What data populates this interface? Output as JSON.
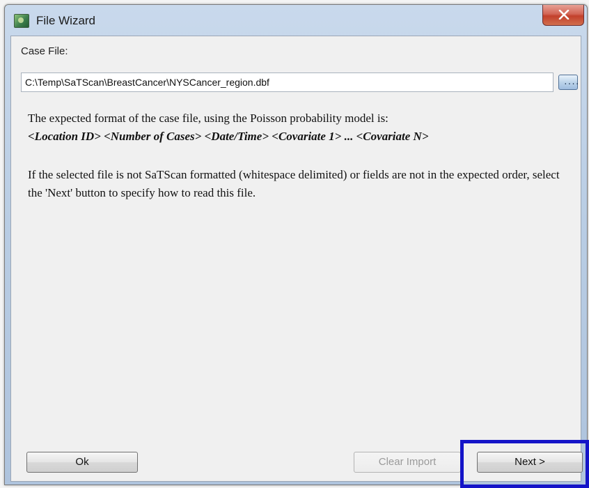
{
  "window": {
    "title": "File Wizard",
    "title_icon": "satscan-app-icon",
    "close_icon": "close-icon"
  },
  "case_file": {
    "label": "Case File:",
    "path": "C:\\Temp\\SaTScan\\BreastCancer\\NYSCancer_region.dbf",
    "browse_label": "...."
  },
  "description": {
    "line1": "The expected format of the case file, using the Poisson probability model is:",
    "format": "<Location ID> <Number of Cases> <Date/Time> <Covariate 1> ... <Covariate N>",
    "line2": "If the selected file is not SaTScan formatted (whitespace delimited) or fields are not in the expected order, select the 'Next' button to specify how to read this file."
  },
  "buttons": {
    "ok": "Ok",
    "clear_import": "Clear Import",
    "next": "Next >"
  },
  "colors": {
    "highlight": "#1414c8",
    "close_button": "#c2402c"
  }
}
